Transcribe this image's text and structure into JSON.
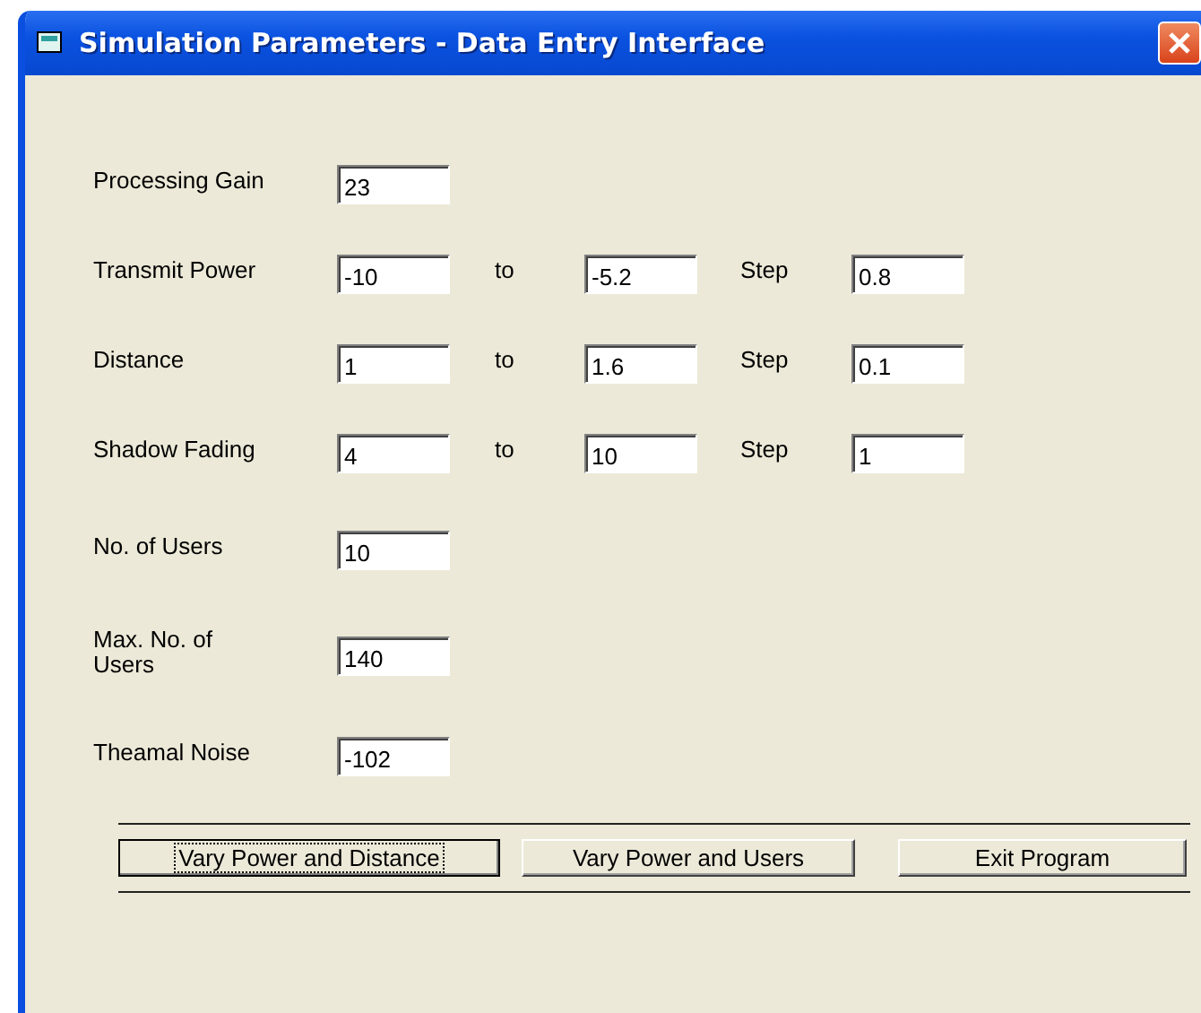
{
  "window": {
    "title": "Simulation Parameters - Data Entry Interface"
  },
  "rows": [
    {
      "kind": "single",
      "label": "Processing Gain",
      "value": "23"
    },
    {
      "kind": "range",
      "label": "Transmit Power",
      "value": "-10",
      "to_label": "to",
      "to_value": "-5.2",
      "step_label": "Step",
      "step_value": "0.8"
    },
    {
      "kind": "range",
      "label": "Distance",
      "value": "1",
      "to_label": "to",
      "to_value": "1.6",
      "step_label": "Step",
      "step_value": "0.1"
    },
    {
      "kind": "range",
      "label": "Shadow Fading",
      "value": "4",
      "to_label": "to",
      "to_value": "10",
      "step_label": "Step",
      "step_value": "1"
    },
    {
      "kind": "single",
      "label": "No. of Users",
      "value": "10"
    },
    {
      "kind": "single",
      "label": "Max. No. of Users",
      "value": "140"
    },
    {
      "kind": "single",
      "label": "Theamal Noise",
      "value": "-102"
    }
  ],
  "buttons": [
    {
      "label": "Vary Power and Distance",
      "focused": true
    },
    {
      "label": "Vary Power and Users",
      "focused": false
    },
    {
      "label": "Exit Program",
      "focused": false
    }
  ]
}
